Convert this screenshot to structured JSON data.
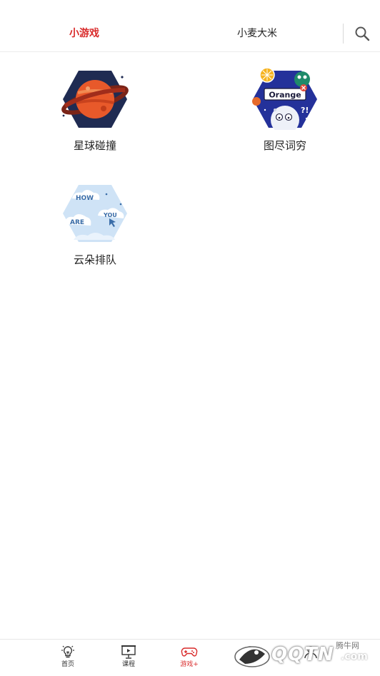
{
  "header": {
    "tabs": [
      {
        "label": "小游戏",
        "active": true
      },
      {
        "label": "小麦大米",
        "active": false
      }
    ],
    "accent_color": "#d92b2b"
  },
  "games": [
    {
      "title": "星球碰撞",
      "icon": "planet-icon"
    },
    {
      "title": "图尽词穷",
      "icon": "orange-moon-icon",
      "badge_text": "Orange"
    },
    {
      "title": "云朵排队",
      "icon": "cloud-words-icon",
      "words": [
        "HOW",
        "ARE",
        "YOU"
      ]
    }
  ],
  "bottom_nav": {
    "items": [
      {
        "label": "首页",
        "icon": "lightbulb-icon",
        "active": false
      },
      {
        "label": "课程",
        "icon": "presentation-board-icon",
        "active": false
      },
      {
        "label": "游戏+",
        "icon": "gamepad-icon",
        "active": true
      },
      {
        "label": "",
        "icon": "hidden-nav-icon",
        "active": false
      },
      {
        "label": "",
        "icon": "profile-icon",
        "active": false
      }
    ]
  },
  "watermark": {
    "main": "QQTN",
    "dotcom": ".com",
    "sub": "腾牛网"
  }
}
